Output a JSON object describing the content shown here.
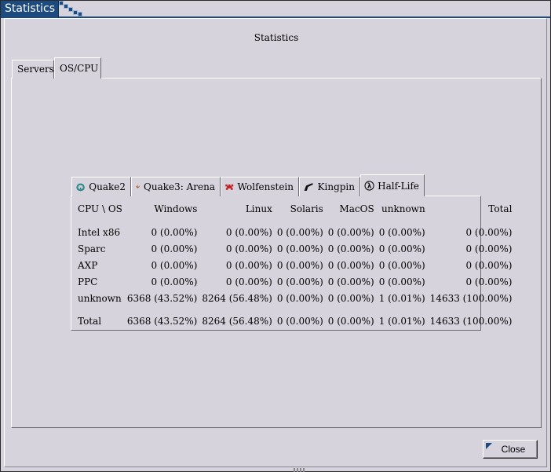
{
  "window": {
    "title": "Statistics",
    "accent": "#1d4b80",
    "background": "#d6d3dc"
  },
  "heading": "Statistics",
  "outer_tabs": [
    {
      "label": "Servers",
      "active": false
    },
    {
      "label": "OS/CPU",
      "active": true
    }
  ],
  "inner_tabs": [
    {
      "label": "Quake2",
      "icon": "quake2-icon",
      "active": false
    },
    {
      "label": "Quake3: Arena",
      "icon": "quake3-icon",
      "active": false
    },
    {
      "label": "Wolfenstein",
      "icon": "wolfenstein-icon",
      "active": false
    },
    {
      "label": "Kingpin",
      "icon": "kingpin-icon",
      "active": false
    },
    {
      "label": "Half-Life",
      "icon": "half-life-icon",
      "active": true
    }
  ],
  "table": {
    "headers": [
      "CPU \\ OS",
      "Windows",
      "Linux",
      "Solaris",
      "MacOS",
      "unknown",
      "Total"
    ],
    "rows": [
      [
        "Intel x86",
        "0 (0.00%)",
        "0 (0.00%)",
        "0 (0.00%)",
        "0 (0.00%)",
        "0 (0.00%)",
        "0 (0.00%)"
      ],
      [
        "Sparc",
        "0 (0.00%)",
        "0 (0.00%)",
        "0 (0.00%)",
        "0 (0.00%)",
        "0 (0.00%)",
        "0 (0.00%)"
      ],
      [
        "AXP",
        "0 (0.00%)",
        "0 (0.00%)",
        "0 (0.00%)",
        "0 (0.00%)",
        "0 (0.00%)",
        "0 (0.00%)"
      ],
      [
        "PPC",
        "0 (0.00%)",
        "0 (0.00%)",
        "0 (0.00%)",
        "0 (0.00%)",
        "0 (0.00%)",
        "0 (0.00%)"
      ],
      [
        "unknown",
        "6368 (43.52%)",
        "8264 (56.48%)",
        "0 (0.00%)",
        "0 (0.00%)",
        "1 (0.01%)",
        "14633 (100.00%)"
      ]
    ],
    "total": [
      "Total",
      "6368 (43.52%)",
      "8264 (56.48%)",
      "0 (0.00%)",
      "0 (0.00%)",
      "1 (0.01%)",
      "14633 (100.00%)"
    ]
  },
  "close_label": "Close"
}
